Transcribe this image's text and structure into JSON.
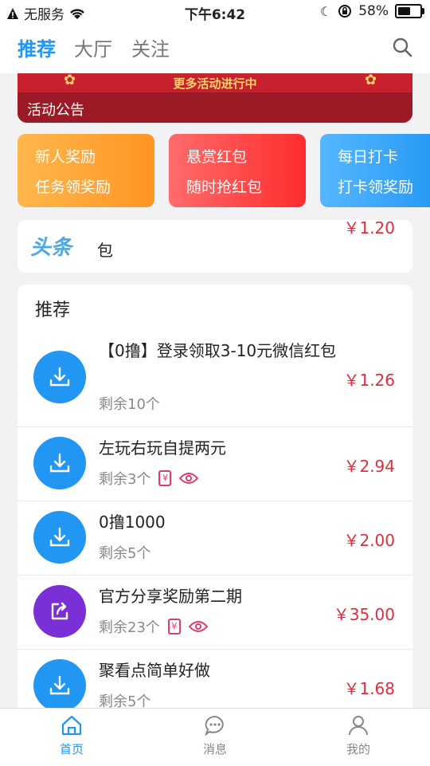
{
  "status": {
    "carrier": "无服务",
    "time": "下午6:42",
    "battery": "58%"
  },
  "topnav": {
    "tabs": [
      "推荐",
      "大厅",
      "关注"
    ],
    "active_tab": "推荐",
    "search_icon": "search-icon"
  },
  "banner": {
    "promo_text": "更多活动进行中",
    "notice_label": "活动公告"
  },
  "promo_cards": [
    {
      "line1": "新人奖励",
      "line2": "任务领奖励"
    },
    {
      "line1": "悬赏红包",
      "line2": "随时抢红包"
    },
    {
      "line1": "每日打卡",
      "line2": "打卡领奖励"
    }
  ],
  "headline": {
    "logo": "头条",
    "text": "包",
    "price": "￥1.20"
  },
  "recommend": {
    "title": "推荐",
    "items": [
      {
        "name": "【0撸】登录领取3-10元微信红包",
        "remain": "剩余10个",
        "price": "￥1.26",
        "icon": "download-icon",
        "tags": []
      },
      {
        "name": "左玩右玩自提两元",
        "remain": "剩余3个",
        "price": "￥2.94",
        "icon": "download-icon",
        "tags": [
          "receipt-icon",
          "eye-icon"
        ]
      },
      {
        "name": "0撸1000",
        "remain": "剩余5个",
        "price": "￥2.00",
        "icon": "download-icon",
        "tags": []
      },
      {
        "name": "官方分享奖励第二期",
        "remain": "剩余23个",
        "price": "￥35.00",
        "icon": "share-icon",
        "tags": [
          "receipt-icon",
          "eye-icon"
        ]
      },
      {
        "name": "聚看点简单好做",
        "remain": "剩余5个",
        "price": "￥1.68",
        "icon": "download-icon",
        "tags": []
      }
    ]
  },
  "bottom_nav": [
    {
      "label": "首页",
      "icon": "home-icon",
      "active": true
    },
    {
      "label": "消息",
      "icon": "message-icon",
      "active": false
    },
    {
      "label": "我的",
      "icon": "profile-icon",
      "active": false
    }
  ],
  "colors": {
    "accent": "#2196f3",
    "price": "#e32c3c",
    "banner": "#c8202d"
  }
}
